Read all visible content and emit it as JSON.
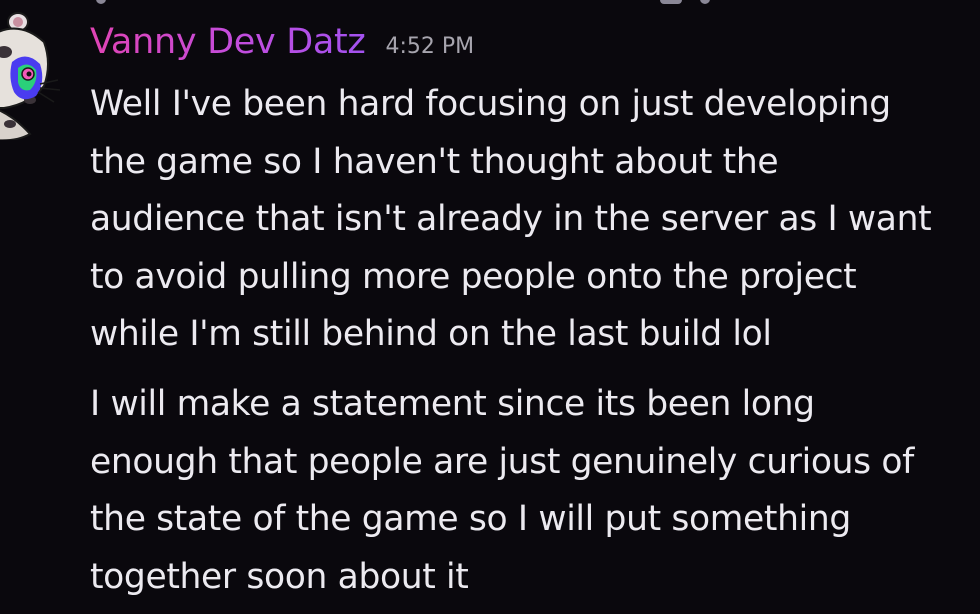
{
  "message": {
    "author": "Vanny Dev Datz",
    "timestamp": "4:52 PM",
    "paragraphs": [
      {
        "lines": [
          "Well I've been hard focusing on just developing",
          "the game so I haven't thought about the",
          "audience that isn't already in the server as I want",
          "to avoid pulling more people onto the project",
          "while I'm still behind on the last build lol"
        ]
      },
      {
        "lines": [
          "I will make a statement since its been long",
          "enough that people are just genuinely curious of",
          "the state of the game so I will put something",
          "together soon about it"
        ]
      }
    ]
  },
  "avatar": {
    "icon": "cartoon-rat-avatar-icon"
  },
  "colors": {
    "background": "#0a080d",
    "username_gradient_start": "#e044b4",
    "username_gradient_end": "#a352f0",
    "text": "#eceaf0",
    "timestamp": "#a7a5ae"
  }
}
